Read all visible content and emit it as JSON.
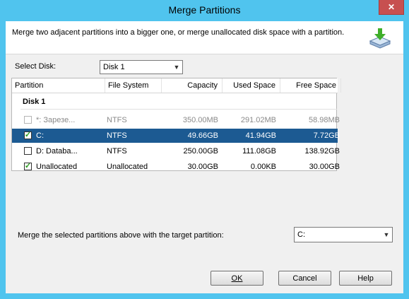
{
  "window": {
    "title": "Merge Partitions",
    "close_glyph": "✕"
  },
  "header": {
    "description": "Merge two adjacent partitions into a bigger one, or merge unallocated disk space with a partition.",
    "icon": "merge-disk-icon"
  },
  "disk_select": {
    "label": "Select Disk:",
    "value": "Disk 1"
  },
  "table": {
    "columns": [
      "Partition",
      "File System",
      "Capacity",
      "Used Space",
      "Free Space"
    ],
    "group": "Disk 1",
    "rows": [
      {
        "partition": "*: Зарезе...",
        "fs": "NTFS",
        "capacity": "350.00MB",
        "used": "291.02MB",
        "free": "58.98MB",
        "checked": false,
        "disabled": true,
        "selected": false
      },
      {
        "partition": "C:",
        "fs": "NTFS",
        "capacity": "49.66GB",
        "used": "41.94GB",
        "free": "7.72GB",
        "checked": true,
        "disabled": false,
        "selected": true
      },
      {
        "partition": "D: Databa...",
        "fs": "NTFS",
        "capacity": "250.00GB",
        "used": "111.08GB",
        "free": "138.92GB",
        "checked": false,
        "disabled": false,
        "selected": false
      },
      {
        "partition": "Unallocated",
        "fs": "Unallocated",
        "capacity": "30.00GB",
        "used": "0.00KB",
        "free": "30.00GB",
        "checked": true,
        "disabled": false,
        "selected": false
      }
    ]
  },
  "target": {
    "label": "Merge the selected partitions above with the target partition:",
    "value": "C:"
  },
  "buttons": {
    "ok": "OK",
    "cancel": "Cancel",
    "help": "Help"
  },
  "colors": {
    "title_bar": "#50c4ee",
    "selection": "#1c5a92",
    "check": "#2a9c1e"
  }
}
